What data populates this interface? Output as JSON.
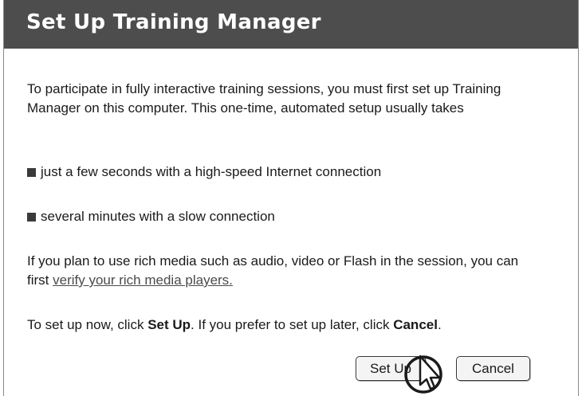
{
  "dialog": {
    "title": "Set Up Training Manager",
    "intro": "To participate in fully interactive training sessions, you must first set up Training Manager on this computer. This one-time, automated setup usually takes",
    "bullets": [
      "just a few seconds with a high-speed Internet connection",
      "several minutes with a slow connection"
    ],
    "rich_media": {
      "text": "If you plan to use rich media such as audio, video or Flash in the session, you can first ",
      "link": "verify your rich media players."
    },
    "instruction": {
      "before": "To set up now, click ",
      "setup_word": "Set Up",
      "middle": ". If you prefer to set up later, click ",
      "cancel_word": "Cancel",
      "after": "."
    },
    "buttons": {
      "setup": "Set Up",
      "cancel": "Cancel"
    }
  },
  "cursor": {
    "icon": "hand-pointer-icon"
  },
  "colors": {
    "titlebar": "#4d4d4d",
    "title_text": "#ffffff",
    "link": "#4a4a4a"
  }
}
